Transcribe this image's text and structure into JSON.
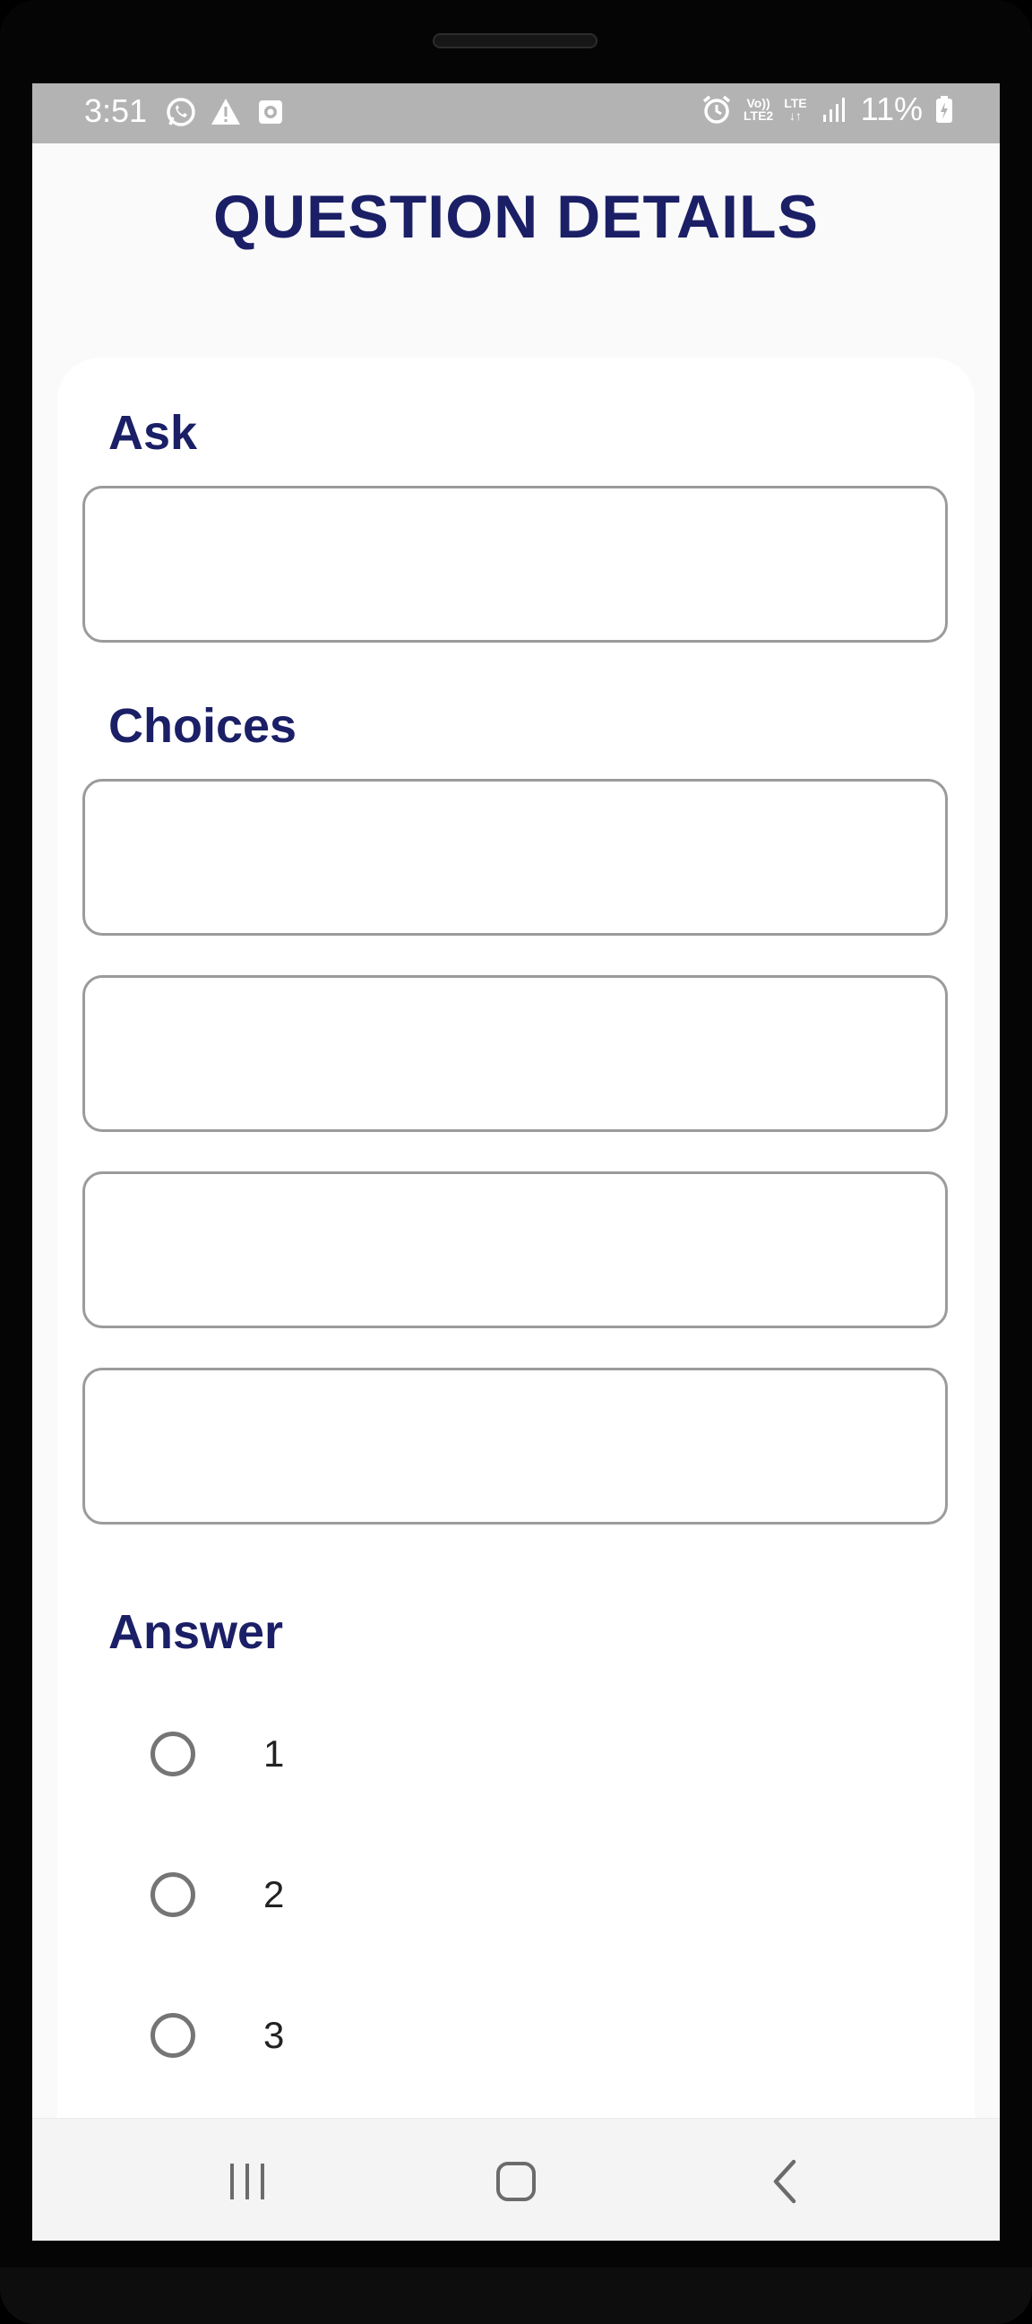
{
  "status_bar": {
    "time": "3:51",
    "battery": "11%",
    "network_top": "Vo))",
    "network_bottom": "LTE2",
    "lte_label": "LTE",
    "left_icons": [
      "whatsapp-icon",
      "warning-icon",
      "screen-record-icon"
    ],
    "right_icons": [
      "alarm-icon",
      "volte-icon",
      "lte-data-icon",
      "signal-icon",
      "battery-charging-icon"
    ]
  },
  "page": {
    "title": "QUESTION DETAILS"
  },
  "form": {
    "ask_label": "Ask",
    "ask_value": "",
    "choices_label": "Choices",
    "choices": [
      {
        "value": ""
      },
      {
        "value": ""
      },
      {
        "value": ""
      },
      {
        "value": ""
      }
    ],
    "answer_label": "Answer",
    "answer_options": [
      {
        "label": "1",
        "selected": false
      },
      {
        "label": "2",
        "selected": false
      },
      {
        "label": "3",
        "selected": false
      }
    ]
  },
  "nav_bar": {
    "buttons": [
      "recent-apps-icon",
      "home-icon",
      "back-icon"
    ]
  },
  "colors": {
    "title": "#1b1f66",
    "status_bar": "#b3b3b3",
    "field_border": "#9b9b9b",
    "radio_border": "#757575"
  }
}
